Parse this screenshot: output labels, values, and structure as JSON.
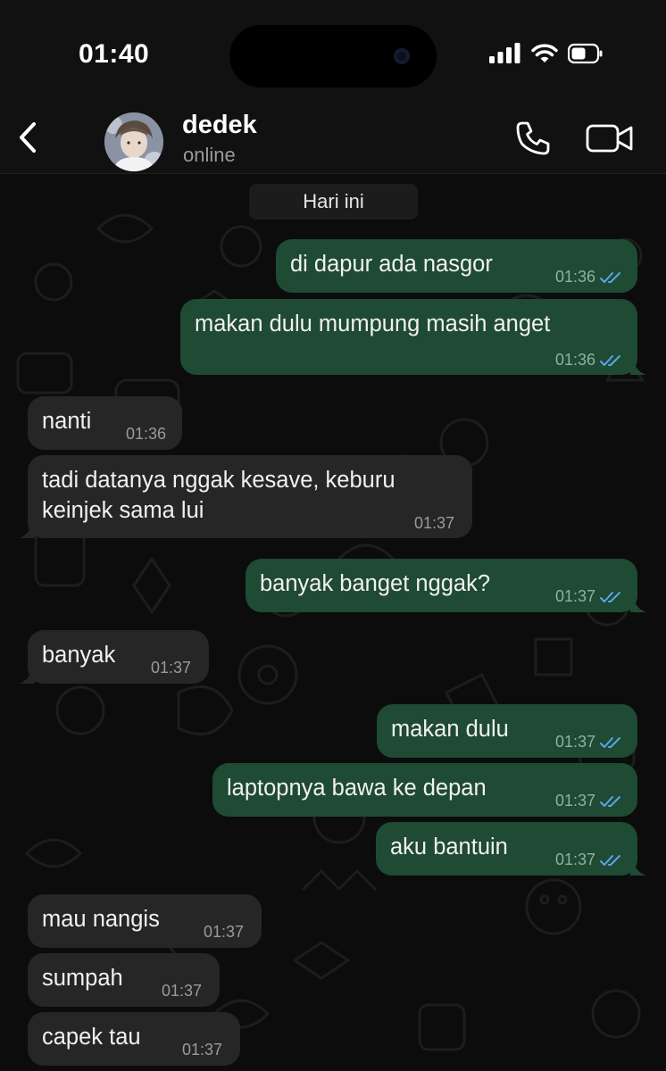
{
  "status_bar": {
    "time": "01:40"
  },
  "header": {
    "back": "back",
    "name": "dedek",
    "status": "online"
  },
  "date_divider": "Hari ini",
  "messages": [
    {
      "dir": "out",
      "text": "di dapur ada nasgor",
      "time": "01:36"
    },
    {
      "dir": "out",
      "text": "makan dulu mumpung masih anget",
      "time": "01:36"
    },
    {
      "dir": "in",
      "text": "nanti",
      "time": "01:36"
    },
    {
      "dir": "in",
      "line1": "tadi datanya nggak kesave, keburu",
      "line2": "keinjek sama lui",
      "time": "01:37"
    },
    {
      "dir": "out",
      "text": "banyak banget nggak?",
      "time": "01:37"
    },
    {
      "dir": "in",
      "text": "banyak",
      "time": "01:37"
    },
    {
      "dir": "out",
      "text": "makan dulu",
      "time": "01:37"
    },
    {
      "dir": "out",
      "text": "laptopnya bawa ke depan",
      "time": "01:37"
    },
    {
      "dir": "out",
      "text": "aku bantuin",
      "time": "01:37"
    },
    {
      "dir": "in",
      "text": "mau nangis",
      "time": "01:37"
    },
    {
      "dir": "in",
      "text": "sumpah",
      "time": "01:37"
    },
    {
      "dir": "in",
      "text": "capek tau",
      "time": "01:37"
    }
  ],
  "icons": {
    "back": "chevron-left-icon",
    "call": "phone-icon",
    "video": "video-camera-icon",
    "read": "double-check-icon",
    "signal": "cellular-signal-icon",
    "wifi": "wifi-icon",
    "battery": "battery-icon"
  },
  "colors": {
    "outgoing_bubble": "#1f4a33",
    "incoming_bubble": "#262626",
    "read_tick": "#5aa5ea",
    "background": "#0c0c0c"
  }
}
